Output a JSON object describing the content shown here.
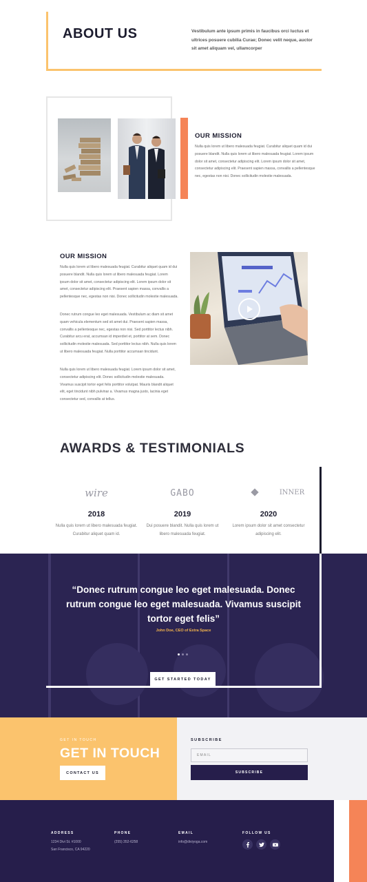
{
  "about": {
    "title": "ABOUT US",
    "text": "Vestibulum ante ipsum primis in faucibus orci luctus et ultrices posuere cubilia Curae; Donec velit neque, auctor sit amet aliquam vel, ullamcorper"
  },
  "mission1": {
    "heading": "OUR MISSION",
    "text": "Nulla quis lorem ut libero malesuada feugiat. Curabitur aliquet quam id dui posuere blandit. Nulla quis lorem ut libero malesuada feugiat. Lorem ipsum dolor sit amet, consectetur adipiscing elit. Lorem ipsum dolor sit amet, consectetur adipiscing elit. Praesent sapien massa, convallis a pellentesque nec, egestas non nisi. Donec sollicitudin molestie malesuada."
  },
  "mission2": {
    "heading": "OUR MISSION",
    "p1": "Nulla quis lorem ut libero malesuada feugiat. Curabitur aliquet quam id dui posuere blandit. Nulla quis lorem ut libero malesuada feugiat. Lorem ipsum dolor sit amet, consectetur adipiscing elit. Lorem ipsum dolor sit amet, consectetur adipiscing elit. Praesent sapien massa, convallis a pellentesque nec, egestas non nisi. Donec sollicitudin molestie malesuada.",
    "p2": "Donec rutrum congue leo eget malesuada. Vestibulum ac diam sit amet quam vehicula elementum sed sit amet dui. Praesent sapien massa, convallis a pellentesque nec, egestas non nisi. Sed porttitor lectus nibh. Curabitur arcu erat, accumsan id imperdiet et, porttitor at sem. Donec sollicitudin molestie malesuada. Sed porttitor lectus nibh. Nulla quis lorem ut libero malesuada feugiat. Nulla porttitor accumsan tincidunt.",
    "p3": "Nulla quis lorem ut libero malesuada feugiat. Lorem ipsum dolor sit amet, consectetur adipiscing elit. Donec sollicitudin molestie malesuada. Vivamus suscipit tortor eget felis porttitor volutpat. Mauris blandit aliquet elit, eget tincidunt nibh pulvinar a. Vivamus magna justo, lacinia eget consectetur sed, convallis at tellus."
  },
  "awards": {
    "title": "AWARDS & TESTIMONIALS",
    "items": [
      {
        "logo": "wire",
        "year": "2018",
        "desc": "Nulla quis lorem ut libero malesuada feugiat. Curabitur aliquet quam id."
      },
      {
        "logo": "GABO",
        "year": "2019",
        "desc": "Dui posuere blandit. Nulla quis lorem ut libero malesuada feugiat."
      },
      {
        "logo": "INNER",
        "year": "2020",
        "desc": "Lorem ipsum dolor sit amet consectetur adipiscing elit."
      }
    ]
  },
  "testimonial": {
    "quote": "“Donec rutrum congue leo eget malesuada. Donec rutrum congue leo eget malesuada. Vivamus suscipit tortor eget felis”",
    "author": "John Doe, CEO of Extra Space",
    "cta": "GET STARTED TODAY"
  },
  "contact": {
    "label": "GET IN TOUCH",
    "title": "GET IN TOUCH",
    "button": "CONTACT US"
  },
  "subscribe": {
    "label": "SUBSCRIBE",
    "placeholder": "EMAIL",
    "button": "SUBSCRIBE"
  },
  "footer": {
    "address_head": "ADDRESS",
    "address_line1": "1234 Divi St. #1000",
    "address_line2": "San Francisco, CA 94220",
    "phone_head": "PHONE",
    "phone": "(255) 352-6258",
    "email_head": "EMAIL",
    "email": "info@diviyoga.com",
    "follow_head": "FOLLOW US",
    "socials": [
      "facebook-icon",
      "twitter-icon",
      "youtube-icon"
    ]
  },
  "colors": {
    "accent_yellow": "#fbc36d",
    "accent_orange": "#f58457",
    "navy": "#261e4b"
  }
}
